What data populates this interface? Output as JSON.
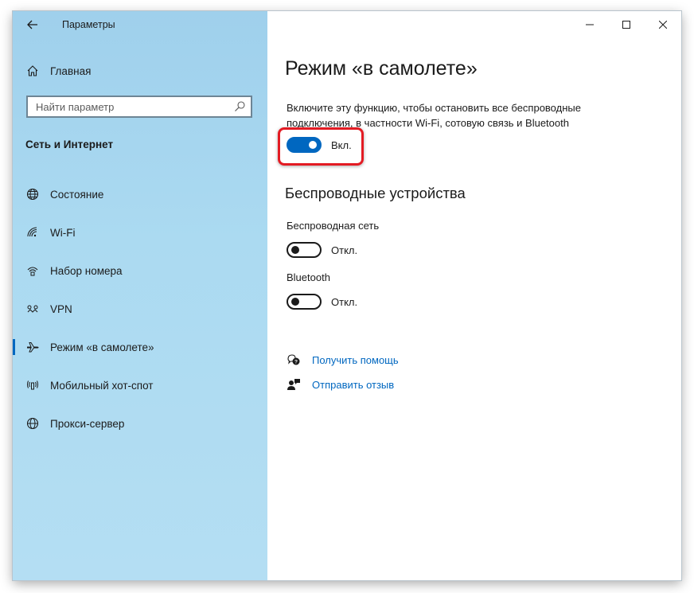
{
  "window": {
    "app_title": "Параметры",
    "back_icon": "arrow-left-icon",
    "controls": [
      "minimize-icon",
      "maximize-icon",
      "close-icon"
    ]
  },
  "sidebar": {
    "home_label": "Главная",
    "search_placeholder": "Найти параметр",
    "section_title": "Сеть и Интернет",
    "items": [
      {
        "label": "Состояние",
        "icon": "globe-status-icon",
        "active": false
      },
      {
        "label": "Wi-Fi",
        "icon": "wifi-icon",
        "active": false
      },
      {
        "label": "Набор номера",
        "icon": "dialup-icon",
        "active": false
      },
      {
        "label": "VPN",
        "icon": "vpn-icon",
        "active": false
      },
      {
        "label": "Режим «в самолете»",
        "icon": "airplane-icon",
        "active": true
      },
      {
        "label": "Мобильный хот-спот",
        "icon": "hotspot-icon",
        "active": false
      },
      {
        "label": "Прокси-сервер",
        "icon": "globe-icon",
        "active": false
      }
    ]
  },
  "main": {
    "title": "Режим «в самолете»",
    "description": "Включите эту функцию, чтобы остановить все беспроводные подключения, в частности Wi-Fi, сотовую связь и Bluetooth",
    "airplane_toggle": {
      "state_label": "Вкл.",
      "on": true
    },
    "wireless_heading": "Беспроводные устройства",
    "wifi_label": "Беспроводная сеть",
    "wifi_toggle": {
      "state_label": "Откл.",
      "on": false
    },
    "bluetooth_label": "Bluetooth",
    "bluetooth_toggle": {
      "state_label": "Откл.",
      "on": false
    },
    "help_link": "Получить помощь",
    "feedback_link": "Отправить отзыв"
  },
  "colors": {
    "accent": "#0067c0",
    "highlight": "#e31b23",
    "sidebar_bg": "#abdaf1"
  }
}
